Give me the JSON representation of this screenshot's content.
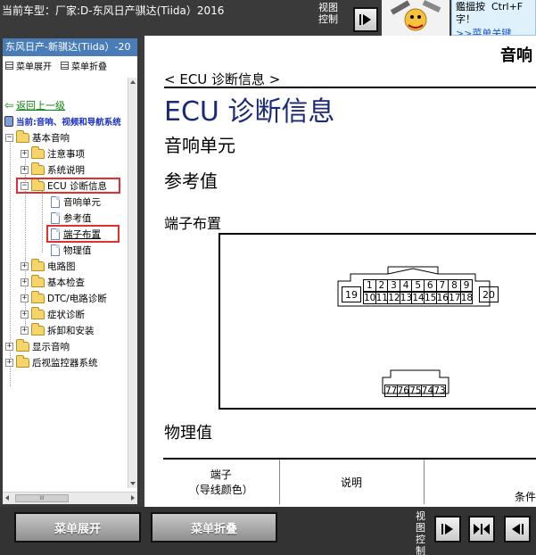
{
  "header": {
    "vehicle_label": "当前车型：厂家:D-东风日产骐达(Tiida）2016",
    "view_control_label": "视图控制",
    "tip_text": "鑑搵按  Ctrl+F\n字！",
    "tip_link": ">>菜单关键"
  },
  "left_panel": {
    "title": "东风日产-新骐达(Tiida）-20",
    "toolbar": {
      "expand_label": "菜单展开",
      "collapse_label": "菜单折叠"
    },
    "back_link": "返回上一级",
    "current_path": "当前:音响、视频和导航系统",
    "tree": {
      "root": "基本音响",
      "notes": "注意事项",
      "system_desc": "系统说明",
      "ecu_info": "ECU 诊断信息",
      "audio_unit": "音响单元",
      "ref_value": "参考值",
      "terminal_layout": "端子布置",
      "physical_value": "物理值",
      "circuit_diagram": "电路图",
      "basic_check": "基本检查",
      "dtc_diag": "DTC/电路诊断",
      "symptom_diag": "症状诊断",
      "removal_install": "拆卸和安装",
      "display_audio": "显示音响",
      "rear_monitor": "后视监控器系统"
    },
    "hscroll_grip": "III"
  },
  "content": {
    "section_heading_top": "音响",
    "breadcrumb": "< ECU 诊断信息 >",
    "main_title": "ECU 诊断信息",
    "subheading_unit": "音响单元",
    "subheading_ref": "参考值",
    "subheading_pins": "端子布置",
    "connector_top": {
      "row1": [
        "1",
        "2",
        "3",
        "4",
        "5",
        "6",
        "7",
        "8",
        "9"
      ],
      "left_pin": "19",
      "row2": [
        "10",
        "11",
        "12",
        "13",
        "14",
        "15",
        "16",
        "17",
        "18"
      ],
      "right_pin": "20"
    },
    "connector_bottom": [
      "77",
      "76",
      "75",
      "74",
      "73"
    ],
    "subheading_phys": "物理值",
    "table": {
      "col_terminal": "端子",
      "col_terminal_sub": "（导线颜色）",
      "col_desc": "说明",
      "col_condition": "条件"
    }
  },
  "footer": {
    "expand_button": "菜单展开",
    "collapse_button": "菜单折叠",
    "view_control_label": "视图控制"
  }
}
